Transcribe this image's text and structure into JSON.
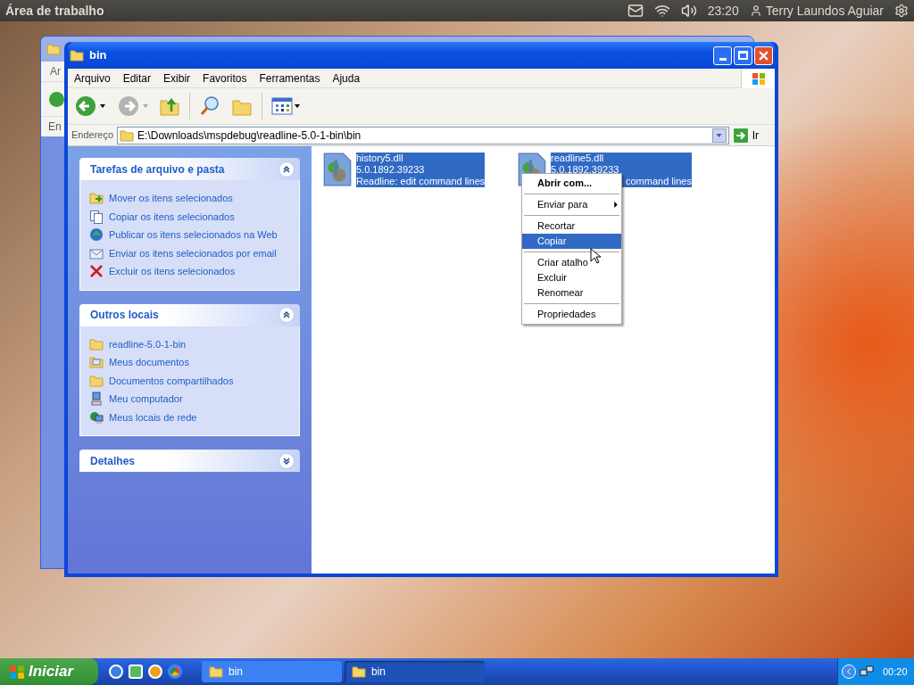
{
  "top_bar": {
    "title": "Área de trabalho",
    "clock": "23:20",
    "user": "Terry Laundos Aguiar"
  },
  "back_window": {
    "menu_fragment": "Ar",
    "address_fragment": "En"
  },
  "window": {
    "title": "bin",
    "menu": [
      "Arquivo",
      "Editar",
      "Exibir",
      "Favoritos",
      "Ferramentas",
      "Ajuda"
    ],
    "address_label": "Endereço",
    "address": "E:\\Downloads\\mspdebug\\readline-5.0-1-bin\\bin",
    "go_label": "Ir",
    "panels": [
      {
        "title": "Tarefas de arquivo e pasta",
        "expanded": true,
        "items": [
          {
            "label": "Mover os itens selecionados"
          },
          {
            "label": "Copiar os itens selecionados"
          },
          {
            "label": "Publicar os itens selecionados na Web"
          },
          {
            "label": "Enviar os itens selecionados por email"
          },
          {
            "label": "Excluir os itens selecionados"
          }
        ]
      },
      {
        "title": "Outros locais",
        "expanded": true,
        "items": [
          {
            "label": "readline-5.0-1-bin"
          },
          {
            "label": "Meus documentos"
          },
          {
            "label": "Documentos compartilhados"
          },
          {
            "label": "Meu computador"
          },
          {
            "label": "Meus locais de rede"
          }
        ]
      },
      {
        "title": "Detalhes",
        "expanded": false
      }
    ],
    "files": [
      {
        "name": "history5.dll",
        "version": "5.0.1892.39233",
        "description": "Readline: edit command lines",
        "selected": true
      },
      {
        "name": "readline5.dll",
        "version": "5.0.1892.39233",
        "description": "command lines",
        "selected": true
      }
    ]
  },
  "context_menu": [
    {
      "kind": "item",
      "label": "Abrir com...",
      "bold": true,
      "submenu": false,
      "selected": false
    },
    {
      "kind": "separator"
    },
    {
      "kind": "item",
      "label": "Enviar para",
      "bold": false,
      "submenu": true,
      "selected": false
    },
    {
      "kind": "separator"
    },
    {
      "kind": "item",
      "label": "Recortar",
      "bold": false,
      "submenu": false,
      "selected": false
    },
    {
      "kind": "item",
      "label": "Copiar",
      "bold": false,
      "submenu": false,
      "selected": true
    },
    {
      "kind": "separator"
    },
    {
      "kind": "item",
      "label": "Criar atalho",
      "bold": false,
      "submenu": false,
      "selected": false
    },
    {
      "kind": "item",
      "label": "Excluir",
      "bold": false,
      "submenu": false,
      "selected": false
    },
    {
      "kind": "item",
      "label": "Renomear",
      "bold": false,
      "submenu": false,
      "selected": false
    },
    {
      "kind": "separator"
    },
    {
      "kind": "item",
      "label": "Propriedades",
      "bold": false,
      "submenu": false,
      "selected": false
    }
  ],
  "taskbar": {
    "start": "Iniciar",
    "tasks": [
      {
        "label": "bin",
        "selected": false
      },
      {
        "label": "bin",
        "selected": true
      }
    ],
    "clock": "00:20"
  }
}
